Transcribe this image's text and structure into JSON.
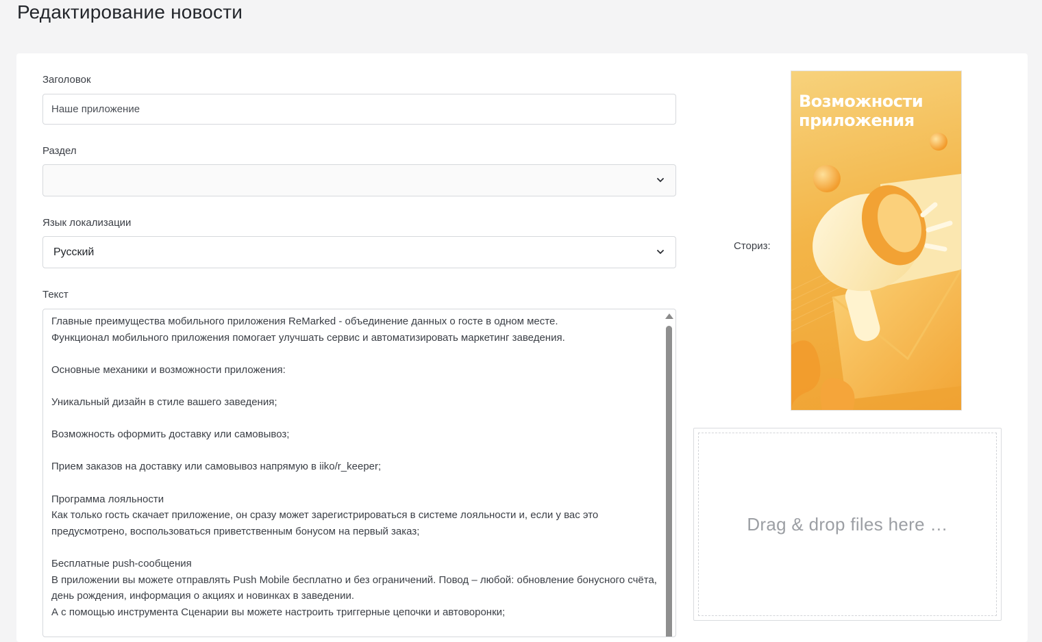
{
  "page": {
    "title": "Редактирование новости"
  },
  "form": {
    "title_label": "Заголовок",
    "title_value": "Наше приложение",
    "section_label": "Раздел",
    "section_value": "",
    "language_label": "Язык локализации",
    "language_value": "Русский",
    "text_label": "Текст",
    "text_value": "Главные преимущества мобильного приложения ReMarked - объединение данных о госте в одном месте.\nФункционал мобильного приложения помогает улучшать сервис и автоматизировать маркетинг заведения.\n\nОсновные механики и возможности приложения:\n\nУникальный дизайн в стиле вашего заведения;\n\nВозможность оформить доставку или самовывоз;\n\nПрием заказов на доставку или самовывоз напрямую в iiko/r_keeper;\n\nПрограмма лояльности\nКак только гость скачает приложение, он сразу может зарегистрироваться в системе лояльности и, если у вас это предусмотрено, воспользоваться приветственным бонусом на первый заказ;\n\nБесплатные push-сообщения\nВ приложении вы можете отправлять Push Mobile бесплатно и без ограничений. Повод – любой: обновление бонусного счёта, день рождения, информация о акциях и новинках в заведении.\nА с помощью инструмента Сценарии вы можете настроить триггерные цепочки и автоворонки;"
  },
  "story": {
    "label": "Сториз:",
    "image_title": "Возможности приложения"
  },
  "dropzone": {
    "text": "Drag & drop files here …"
  },
  "colors": {
    "background": "#f4f4f5",
    "card": "#ffffff",
    "story_gradient_top": "#f7d27c",
    "story_gradient_bottom": "#f0a232"
  },
  "icons": {
    "select_chevron": "chevron-down-icon",
    "scroll_up": "scroll-up-arrow-icon"
  }
}
